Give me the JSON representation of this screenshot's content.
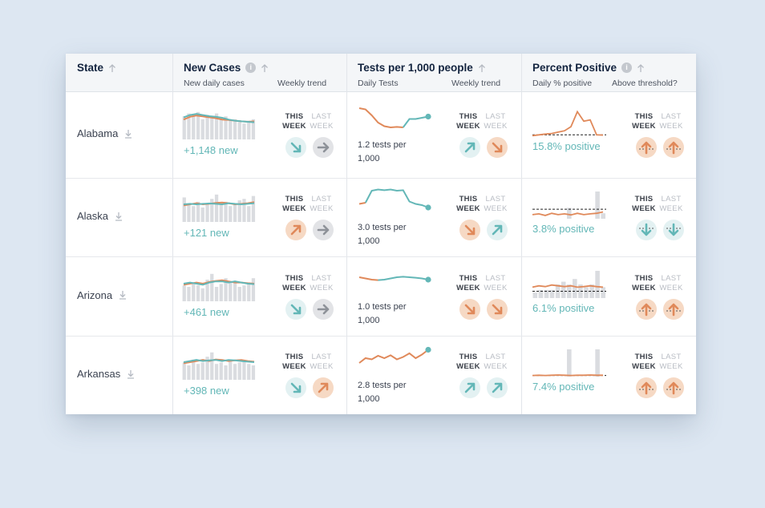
{
  "header": {
    "state": "State",
    "cases": "New Cases",
    "cases_sub1": "New daily cases",
    "cases_sub2": "Weekly trend",
    "tests": "Tests per 1,000 people",
    "tests_sub1": "Daily Tests",
    "tests_sub2": "Weekly trend",
    "pct": "Percent Positive",
    "pct_sub1": "Daily % positive",
    "pct_sub2": "Above threshold?",
    "info_glyph": "i"
  },
  "week": {
    "this1": "THIS",
    "this2": "WEEK",
    "last1": "LAST",
    "last2": "WEEK"
  },
  "colors": {
    "teal": "#63b7b7",
    "orange": "#e0895a",
    "gray": "#8e9299",
    "bar": "#dadce0"
  },
  "rows": [
    {
      "state": "Alabama",
      "cases": "+1,148 new",
      "tests": "1.2 tests per 1,000",
      "pct": "15.8% positive",
      "cases_this": "down-teal",
      "cases_last": "right-gray",
      "tests_this": "up-teal",
      "tests_last": "down-orange",
      "pct_this": "above-orange",
      "pct_last": "above-orange",
      "cases_bars": [
        0.8,
        0.9,
        0.85,
        0.95,
        0.7,
        0.85,
        0.8,
        0.9,
        0.75,
        0.8,
        0.65,
        0.7,
        0.6,
        0.55,
        0.65,
        0.7
      ],
      "cases_teal": [
        0.7,
        0.8,
        0.85,
        0.8,
        0.75,
        0.72,
        0.68,
        0.6,
        0.55,
        0.52,
        0.5,
        0.48
      ],
      "cases_orange": [
        0.6,
        0.72,
        0.78,
        0.74,
        0.7,
        0.66,
        0.6,
        0.58,
        0.55,
        0.52,
        0.5,
        0.52
      ],
      "tests_line": [
        0.9,
        0.85,
        0.6,
        0.3,
        0.15,
        0.1,
        0.12,
        0.1,
        0.45,
        0.45,
        0.5,
        0.55
      ],
      "tests_split": 8,
      "pct_line": [
        0.02,
        0.05,
        0.08,
        0.1,
        0.15,
        0.2,
        0.35,
        0.9,
        0.55,
        0.6,
        0.05,
        0.04
      ],
      "pct_threshold": 0.05
    },
    {
      "state": "Alaska",
      "cases": "+121 new",
      "tests": "3.0 tests per 1,000",
      "pct": "3.8% positive",
      "cases_this": "up-orange",
      "cases_last": "right-gray",
      "tests_this": "down-orange",
      "tests_last": "up-teal",
      "pct_this": "below-teal",
      "pct_last": "below-teal",
      "cases_bars": [
        0.85,
        0.6,
        0.55,
        0.7,
        0.5,
        0.6,
        0.8,
        0.95,
        0.6,
        0.7,
        0.55,
        0.6,
        0.75,
        0.8,
        0.55,
        0.9
      ],
      "cases_teal": [
        0.5,
        0.52,
        0.5,
        0.52,
        0.54,
        0.52,
        0.5,
        0.55,
        0.52,
        0.5,
        0.52,
        0.55
      ],
      "cases_orange": [
        0.45,
        0.5,
        0.55,
        0.5,
        0.52,
        0.56,
        0.58,
        0.55,
        0.5,
        0.52,
        0.55,
        0.6
      ],
      "tests_line": [
        0.35,
        0.4,
        0.9,
        0.95,
        0.92,
        0.95,
        0.9,
        0.92,
        0.45,
        0.35,
        0.3,
        0.2
      ],
      "tests_split": 2,
      "pct_line": [
        0.15,
        0.18,
        0.12,
        0.2,
        0.15,
        0.18,
        0.14,
        0.2,
        0.15,
        0.18,
        0.2,
        0.25
      ],
      "pct_bars": [
        0,
        0,
        0,
        0,
        0,
        0,
        0.4,
        0,
        0,
        0,
        0,
        1.0,
        0.2
      ],
      "pct_threshold": 0.35
    },
    {
      "state": "Arizona",
      "cases": "+461 new",
      "tests": "1.0 tests per 1,000",
      "pct": "6.1% positive",
      "cases_this": "down-teal",
      "cases_last": "right-gray",
      "tests_this": "down-orange",
      "tests_last": "down-orange",
      "pct_this": "above-orange",
      "pct_last": "above-orange",
      "cases_bars": [
        0.55,
        0.5,
        0.6,
        0.55,
        0.45,
        0.75,
        0.95,
        0.5,
        0.6,
        0.8,
        0.7,
        0.65,
        0.5,
        0.55,
        0.6,
        0.8
      ],
      "cases_teal": [
        0.5,
        0.55,
        0.5,
        0.45,
        0.55,
        0.6,
        0.6,
        0.55,
        0.6,
        0.55,
        0.5,
        0.48
      ],
      "cases_orange": [
        0.45,
        0.5,
        0.55,
        0.5,
        0.58,
        0.62,
        0.65,
        0.6,
        0.55,
        0.55,
        0.52,
        0.5
      ],
      "tests_line": [
        0.6,
        0.55,
        0.5,
        0.48,
        0.5,
        0.55,
        0.6,
        0.62,
        0.6,
        0.58,
        0.55,
        0.5
      ],
      "tests_split": 4,
      "pct_line": [
        0.4,
        0.45,
        0.42,
        0.48,
        0.45,
        0.42,
        0.45,
        0.4,
        0.42,
        0.45,
        0.42,
        0.4
      ],
      "pct_bars": [
        0.2,
        0.3,
        0.3,
        0.3,
        0.5,
        0.6,
        0.5,
        0.7,
        0.5,
        0.4,
        0.5,
        1.0,
        0.4
      ],
      "pct_threshold": 0.25
    },
    {
      "state": "Arkansas",
      "cases": "+398 new",
      "tests": "2.8 tests per 1,000",
      "pct": "7.4% positive",
      "cases_this": "down-teal",
      "cases_last": "up-orange",
      "tests_this": "up-teal",
      "tests_last": "up-teal",
      "pct_this": "above-orange",
      "pct_last": "above-orange",
      "cases_bars": [
        0.6,
        0.5,
        0.7,
        0.55,
        0.6,
        0.8,
        0.95,
        0.55,
        0.6,
        0.5,
        0.7,
        0.55,
        0.6,
        0.65,
        0.55,
        0.5
      ],
      "cases_teal": [
        0.5,
        0.55,
        0.6,
        0.55,
        0.58,
        0.6,
        0.55,
        0.6,
        0.58,
        0.55,
        0.52,
        0.5
      ],
      "cases_orange": [
        0.45,
        0.5,
        0.55,
        0.6,
        0.55,
        0.62,
        0.6,
        0.55,
        0.58,
        0.6,
        0.55,
        0.52
      ],
      "tests_line": [
        0.3,
        0.5,
        0.45,
        0.6,
        0.5,
        0.62,
        0.45,
        0.55,
        0.7,
        0.5,
        0.65,
        0.85
      ],
      "tests_split": 12,
      "pct_line": [
        0.04,
        0.05,
        0.04,
        0.05,
        0.06,
        0.05,
        0.04,
        0.05,
        0.05,
        0.06,
        0.05,
        0.05
      ],
      "pct_bars": [
        0,
        0,
        0,
        0,
        0,
        0,
        1.0,
        0,
        0,
        0,
        0,
        1.0,
        0
      ],
      "pct_threshold": 0.04
    }
  ]
}
